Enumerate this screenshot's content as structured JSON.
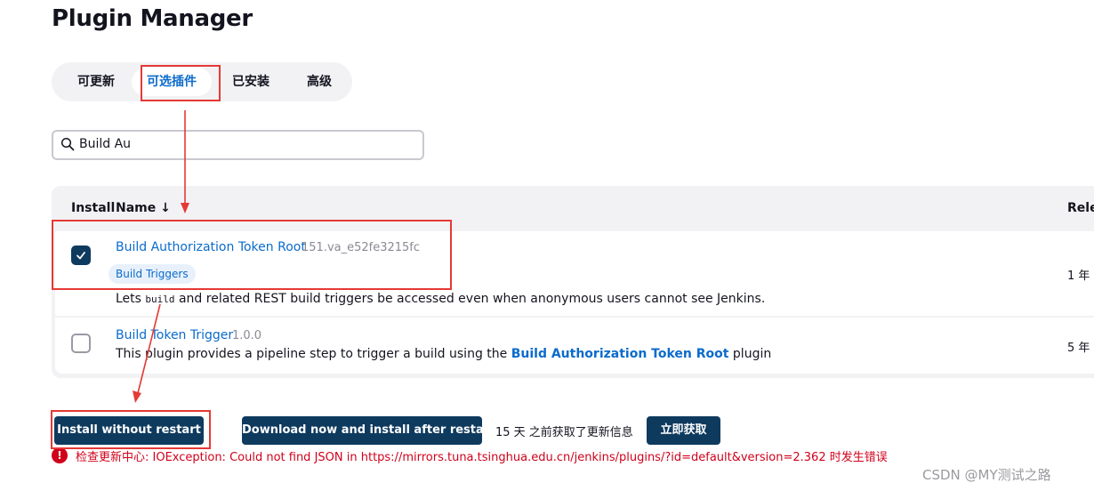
{
  "page": {
    "title": "Plugin Manager"
  },
  "tabs": [
    {
      "label": "可更新",
      "active": false
    },
    {
      "label": "可选插件",
      "active": true
    },
    {
      "label": "已安装",
      "active": false
    },
    {
      "label": "高级",
      "active": false
    }
  ],
  "search": {
    "value": "Build Au",
    "icon": "search-icon"
  },
  "table": {
    "headers": {
      "install": "Install",
      "name": "Name ↓",
      "released": "Relea"
    },
    "rows": [
      {
        "name": "Build Authorization Token Root",
        "version": "151.va_e52fe3215fc",
        "tag": "Build Triggers",
        "description_prefix": "Lets ",
        "description_code": "build",
        "description_suffix": " and related REST build triggers be accessed even when anonymous users cannot see Jenkins.",
        "released": "1 年",
        "checked": true
      },
      {
        "name": "Build Token Trigger",
        "version": "1.0.0",
        "description_prefix": "This plugin provides a pipeline step to trigger a build using the ",
        "description_link": "Build Authorization Token Root",
        "description_suffix": " plugin",
        "released": "5 年",
        "checked": false
      }
    ]
  },
  "actions": {
    "install_without_restart": "Install without restart",
    "download_install_after_restart": "Download now and install after restart",
    "update_info": "15 天 之前获取了更新信息",
    "fetch_now": "立即获取"
  },
  "error": {
    "icon": "error-icon",
    "text": "检查更新中心: IOException: Could not find JSON in https://mirrors.tuna.tsinghua.edu.cn/jenkins/plugins/?id=default&version=2.362 时发生错误"
  },
  "watermark": "CSDN @MY测试之路",
  "colors": {
    "accent": "#0b6bcb",
    "button": "#0e3a5e",
    "annotation": "#e53935",
    "error": "#d0021b"
  }
}
